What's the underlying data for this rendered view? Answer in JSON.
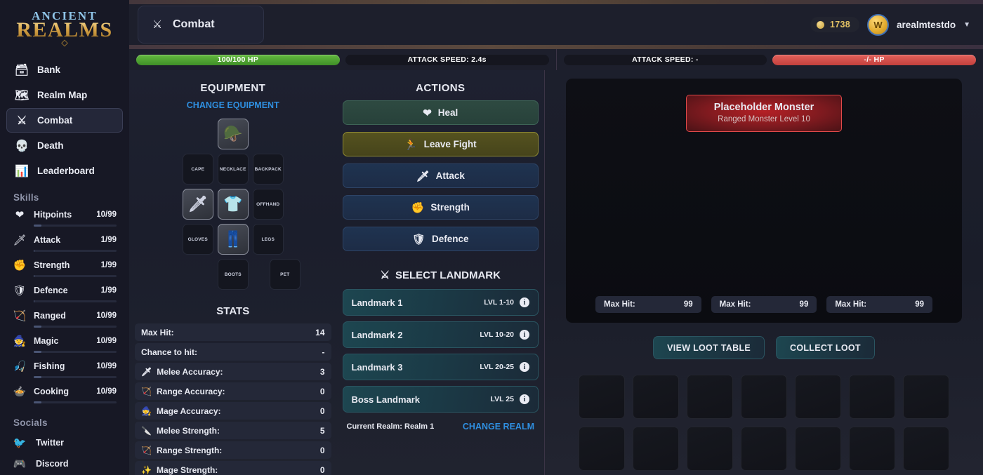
{
  "brand": {
    "line1": "ANCIENT",
    "line2": "REALMS"
  },
  "nav": {
    "items": [
      {
        "label": "Bank",
        "icon": "chest-icon",
        "glyph": "🗃",
        "active": false
      },
      {
        "label": "Realm Map",
        "icon": "map-icon",
        "glyph": "🗺",
        "active": false
      },
      {
        "label": "Combat",
        "icon": "crossed-swords-icon",
        "glyph": "⚔",
        "active": true
      },
      {
        "label": "Death",
        "icon": "skull-icon",
        "glyph": "💀",
        "active": false
      },
      {
        "label": "Leaderboard",
        "icon": "leaderboard-icon",
        "glyph": "📊",
        "active": false
      }
    ]
  },
  "skills": {
    "title": "Skills",
    "items": [
      {
        "name": "Hitpoints",
        "value": "10/99",
        "icon": "heart-icon",
        "glyph": "❤",
        "progress": 9
      },
      {
        "name": "Attack",
        "value": "1/99",
        "icon": "sword-icon",
        "glyph": "🗡",
        "progress": 1
      },
      {
        "name": "Strength",
        "value": "1/99",
        "icon": "fist-icon",
        "glyph": "✊",
        "progress": 1
      },
      {
        "name": "Defence",
        "value": "1/99",
        "icon": "shield-icon",
        "glyph": "🛡",
        "progress": 1
      },
      {
        "name": "Ranged",
        "value": "10/99",
        "icon": "bow-icon",
        "glyph": "🏹",
        "progress": 9
      },
      {
        "name": "Magic",
        "value": "10/99",
        "icon": "wizard-hat-icon",
        "glyph": "🧙",
        "progress": 9
      },
      {
        "name": "Fishing",
        "value": "10/99",
        "icon": "fishing-icon",
        "glyph": "🎣",
        "progress": 9
      },
      {
        "name": "Cooking",
        "value": "10/99",
        "icon": "cooking-pot-icon",
        "glyph": "🍲",
        "progress": 9
      }
    ]
  },
  "socials": {
    "title": "Socials",
    "items": [
      {
        "label": "Twitter",
        "icon": "twitter-icon",
        "glyph": "🐦"
      },
      {
        "label": "Discord",
        "icon": "discord-icon",
        "glyph": "🎮"
      }
    ]
  },
  "header": {
    "tab_label": "Combat",
    "tab_icon": "crossed-swords-icon",
    "gold": "1738",
    "avatar_letter": "W",
    "username": "arealmtestdo",
    "caret": "▼"
  },
  "bars": {
    "player_hp": "100/100 HP",
    "player_hp_percent": 100,
    "player_speed": "ATTACK SPEED: 2.4s",
    "enemy_speed": "ATTACK SPEED: -",
    "enemy_hp": "-/- HP",
    "enemy_hp_percent": 100
  },
  "equipment": {
    "title": "EQUIPMENT",
    "change_label": "CHANGE EQUIPMENT",
    "slots": [
      {
        "label": "HELMET",
        "filled": true,
        "glyph": "🪖"
      },
      {
        "label": "CAPE",
        "filled": false,
        "glyph": ""
      },
      {
        "label": "NECKLACE",
        "filled": false,
        "glyph": ""
      },
      {
        "label": "BACKPACK",
        "filled": false,
        "glyph": ""
      },
      {
        "label": "WEAPON",
        "filled": true,
        "glyph": "🗡"
      },
      {
        "label": "BODY",
        "filled": true,
        "glyph": "👕"
      },
      {
        "label": "OFFHAND",
        "filled": false,
        "glyph": ""
      },
      {
        "label": "GLOVES",
        "filled": false,
        "glyph": ""
      },
      {
        "label": "LEGS_EQUIPPED",
        "filled": true,
        "glyph": "👖"
      },
      {
        "label": "LEGS",
        "filled": false,
        "glyph": ""
      },
      {
        "label": "BOOTS",
        "filled": false,
        "glyph": ""
      },
      {
        "label": "PET",
        "filled": false,
        "glyph": ""
      }
    ]
  },
  "stats": {
    "title": "STATS",
    "rows": [
      {
        "label": "Max Hit:",
        "value": "14",
        "icon": "none",
        "glyph": ""
      },
      {
        "label": "Chance to hit:",
        "value": "-",
        "icon": "none",
        "glyph": ""
      },
      {
        "label": "Melee Accuracy:",
        "value": "3",
        "icon": "sword-icon",
        "glyph": "🗡"
      },
      {
        "label": "Range Accuracy:",
        "value": "0",
        "icon": "bow-icon",
        "glyph": "🏹"
      },
      {
        "label": "Mage Accuracy:",
        "value": "0",
        "icon": "wizard-hat-icon",
        "glyph": "🧙"
      },
      {
        "label": "Melee Strength:",
        "value": "5",
        "icon": "dagger-icon",
        "glyph": "🔪"
      },
      {
        "label": "Range Strength:",
        "value": "0",
        "icon": "bow-icon",
        "glyph": "🏹"
      },
      {
        "label": "Mage Strength:",
        "value": "0",
        "icon": "sparkle-icon",
        "glyph": "✨"
      }
    ]
  },
  "actions": {
    "title": "ACTIONS",
    "buttons": [
      {
        "label": "Heal",
        "icon": "heart-icon",
        "glyph": "❤",
        "style": "heal"
      },
      {
        "label": "Leave Fight",
        "icon": "running-icon",
        "glyph": "🏃",
        "style": "leave"
      },
      {
        "label": "Attack",
        "icon": "sword-icon",
        "glyph": "🗡",
        "style": "blue"
      },
      {
        "label": "Strength",
        "icon": "fist-icon",
        "glyph": "✊",
        "style": "blue"
      },
      {
        "label": "Defence",
        "icon": "shield-icon",
        "glyph": "🛡",
        "style": "blue"
      }
    ]
  },
  "landmarks": {
    "title": "SELECT LANDMARK",
    "title_icon": "crossed-swords-icon",
    "items": [
      {
        "name": "Landmark 1",
        "level": "LVL 1-10",
        "info": "i"
      },
      {
        "name": "Landmark 2",
        "level": "LVL 10-20",
        "info": "i"
      },
      {
        "name": "Landmark 3",
        "level": "LVL 20-25",
        "info": "i"
      },
      {
        "name": "Boss Landmark",
        "level": "LVL 25",
        "info": "i"
      }
    ],
    "current_realm": "Current Realm: Realm 1",
    "change_realm": "CHANGE REALM"
  },
  "enemy": {
    "name": "Placeholder Monster",
    "subtitle": "Ranged Monster Level 10",
    "max_hits": [
      {
        "label": "Max Hit:",
        "value": "99"
      },
      {
        "label": "Max Hit:",
        "value": "99"
      },
      {
        "label": "Max Hit:",
        "value": "99"
      }
    ],
    "view_loot_label": "VIEW LOOT TABLE",
    "collect_loot_label": "COLLECT LOOT",
    "loot_slot_count": 14
  }
}
